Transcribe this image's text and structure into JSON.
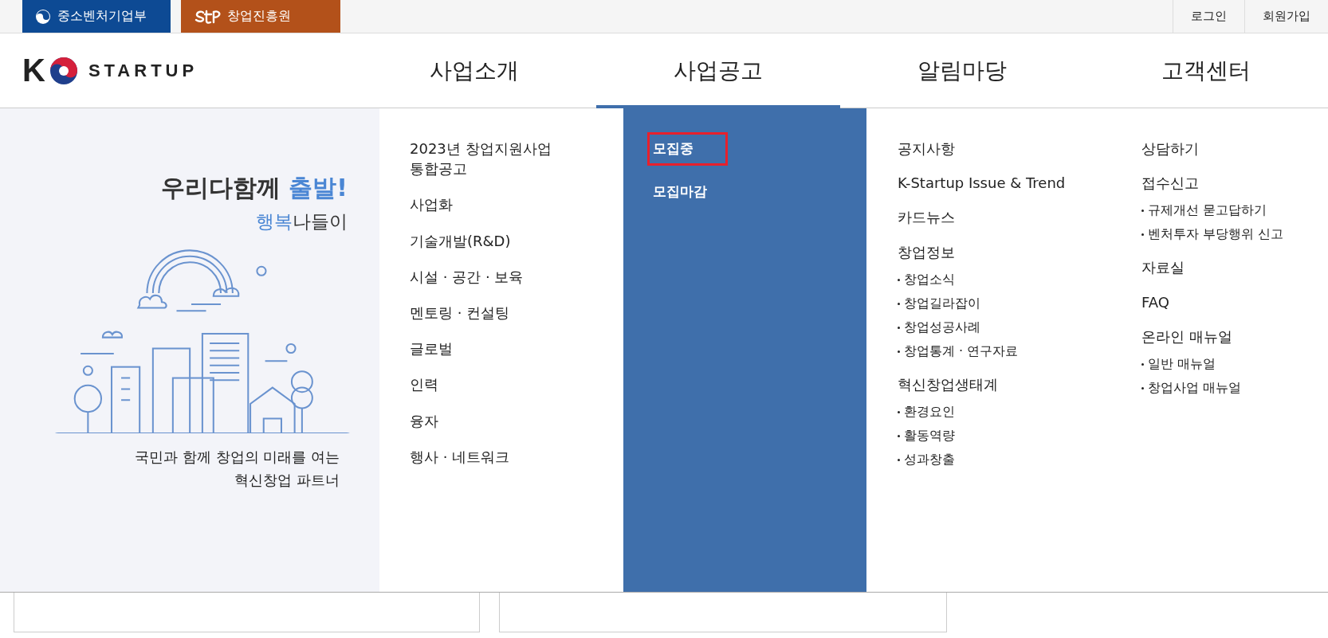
{
  "top_bar": {
    "agencies": [
      {
        "name": "중소벤처기업부",
        "kind": "ministry"
      },
      {
        "name": "창업진흥원",
        "kind": "institute"
      }
    ],
    "links": [
      "로그인",
      "회원가입"
    ]
  },
  "logo": {
    "letter": "K",
    "word": "STARTUP"
  },
  "nav": [
    {
      "label": "사업소개",
      "selected": false
    },
    {
      "label": "사업공고",
      "selected": true
    },
    {
      "label": "알림마당",
      "selected": false
    },
    {
      "label": "고객센터",
      "selected": false
    }
  ],
  "promo": {
    "slogan": "우리다함께",
    "slogan_accent": "출발!",
    "sub_accent": "행복",
    "sub": "나들이",
    "tagline": "국민과 함께 창업의 미래를 여는\n혁신창업 파트너"
  },
  "menu_columns": [
    {
      "items": [
        {
          "label": "2023년 창업지원사업\n통합공고"
        },
        {
          "label": "사업화"
        },
        {
          "label": "기술개발(R&D)"
        },
        {
          "label": "시설 · 공간 · 보육"
        },
        {
          "label": "멘토링 · 컨설팅"
        },
        {
          "label": "글로벌"
        },
        {
          "label": "인력"
        },
        {
          "label": "융자"
        },
        {
          "label": "행사 · 네트워크"
        }
      ]
    },
    {
      "items": [
        {
          "label": "모집중",
          "highlighted": true
        },
        {
          "label": "모집마감",
          "highlighted": false
        }
      ]
    },
    {
      "items": [
        {
          "label": "공지사항"
        },
        {
          "label": "K-Startup Issue & Trend"
        },
        {
          "label": "카드뉴스"
        },
        {
          "label": "창업정보",
          "children": [
            {
              "label": "창업소식"
            },
            {
              "label": "창업길라잡이"
            },
            {
              "label": "창업성공사례"
            },
            {
              "label": "창업통계 · 연구자료"
            }
          ]
        },
        {
          "label": "혁신창업생태계",
          "children": [
            {
              "label": "환경요인"
            },
            {
              "label": "활동역량"
            },
            {
              "label": "성과창출"
            }
          ]
        }
      ]
    },
    {
      "items": [
        {
          "label": "상담하기"
        },
        {
          "label": "접수신고",
          "children": [
            {
              "label": "규제개선 묻고답하기"
            },
            {
              "label": "벤처투자 부당행위 신고"
            }
          ]
        },
        {
          "label": "자료실"
        },
        {
          "label": "FAQ"
        },
        {
          "label": "온라인 매뉴얼",
          "children": [
            {
              "label": "일반 매뉴얼"
            },
            {
              "label": "창업사업 매뉴얼"
            }
          ]
        }
      ]
    }
  ]
}
